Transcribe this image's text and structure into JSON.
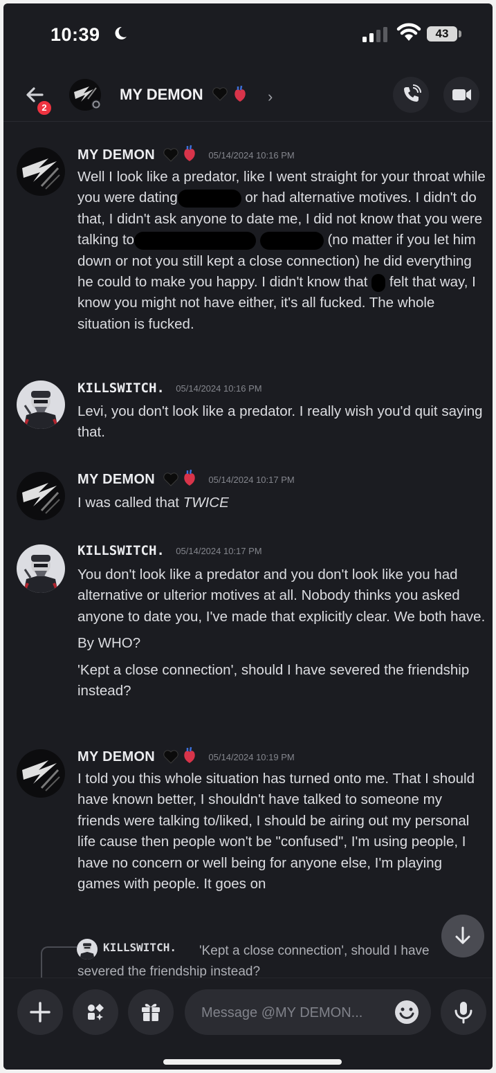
{
  "status_bar": {
    "time": "10:39",
    "battery": "43",
    "icons": [
      "moon-icon",
      "signal-icon",
      "wifi-icon",
      "battery-icon"
    ]
  },
  "header": {
    "back_badge": "2",
    "title": "MY DEMON",
    "chevron": "›",
    "icons": [
      "back-arrow-icon",
      "black-heart-icon",
      "anatomical-heart-icon",
      "phone-call-icon",
      "video-camera-icon"
    ]
  },
  "messages": [
    {
      "author": "MY DEMON",
      "timestamp": "05/14/2024 10:16 PM",
      "paragraphs": [
        {
          "t1": "Well I look like a predator, like I went straight for your throat while you were dating",
          "t2": " or had alternative motives. I didn't do that, I didn't ask anyone to date me, I did not know that you were talking to",
          "t3": " (no matter if you let him down or not you still kept a close connection) he did everything he could to make you happy. I didn't know that",
          "t4": " felt that way, I know you might not have either, it's all fucked. The whole situation is fucked."
        }
      ]
    },
    {
      "author": "KILLSWITCH.",
      "timestamp": "05/14/2024 10:16 PM",
      "paragraphs": [
        "Levi, you don't look like a predator. I really wish you'd quit saying that."
      ]
    },
    {
      "author": "MY DEMON",
      "timestamp": "05/14/2024 10:17 PM",
      "paragraphs": [
        {
          "t1": "I was called that ",
          "em": "TWICE"
        }
      ]
    },
    {
      "author": "KILLSWITCH.",
      "timestamp": "05/14/2024 10:17 PM",
      "paragraphs": [
        "You don't look like a predator and you don't look like you had alternative or ulterior motives at all. Nobody thinks you asked anyone to date you, I've made that explicitly clear. We both have.",
        "By WHO?",
        "'Kept a close connection', should I have severed the friendship instead?"
      ]
    },
    {
      "author": "MY DEMON",
      "timestamp": "05/14/2024 10:19 PM",
      "paragraphs": [
        "I told you this whole situation has turned onto me. That I should have known better, I shouldn't have talked to someone my friends were talking to/liked, I should be airing out my personal life cause then people won't be \"confused\", I'm using people, I have no concern or well being for anyone else, I'm playing games with people. It goes on"
      ]
    }
  ],
  "reply_preview": {
    "author": "KILLSWITCH.",
    "text": "'Kept a close connection', should I have severed the friendship instead?"
  },
  "composer": {
    "placeholder": "Message @MY DEMON...",
    "icons": [
      "plus-icon",
      "apps-icon",
      "gift-icon",
      "emoji-icon",
      "microphone-icon",
      "arrow-down-icon"
    ]
  }
}
